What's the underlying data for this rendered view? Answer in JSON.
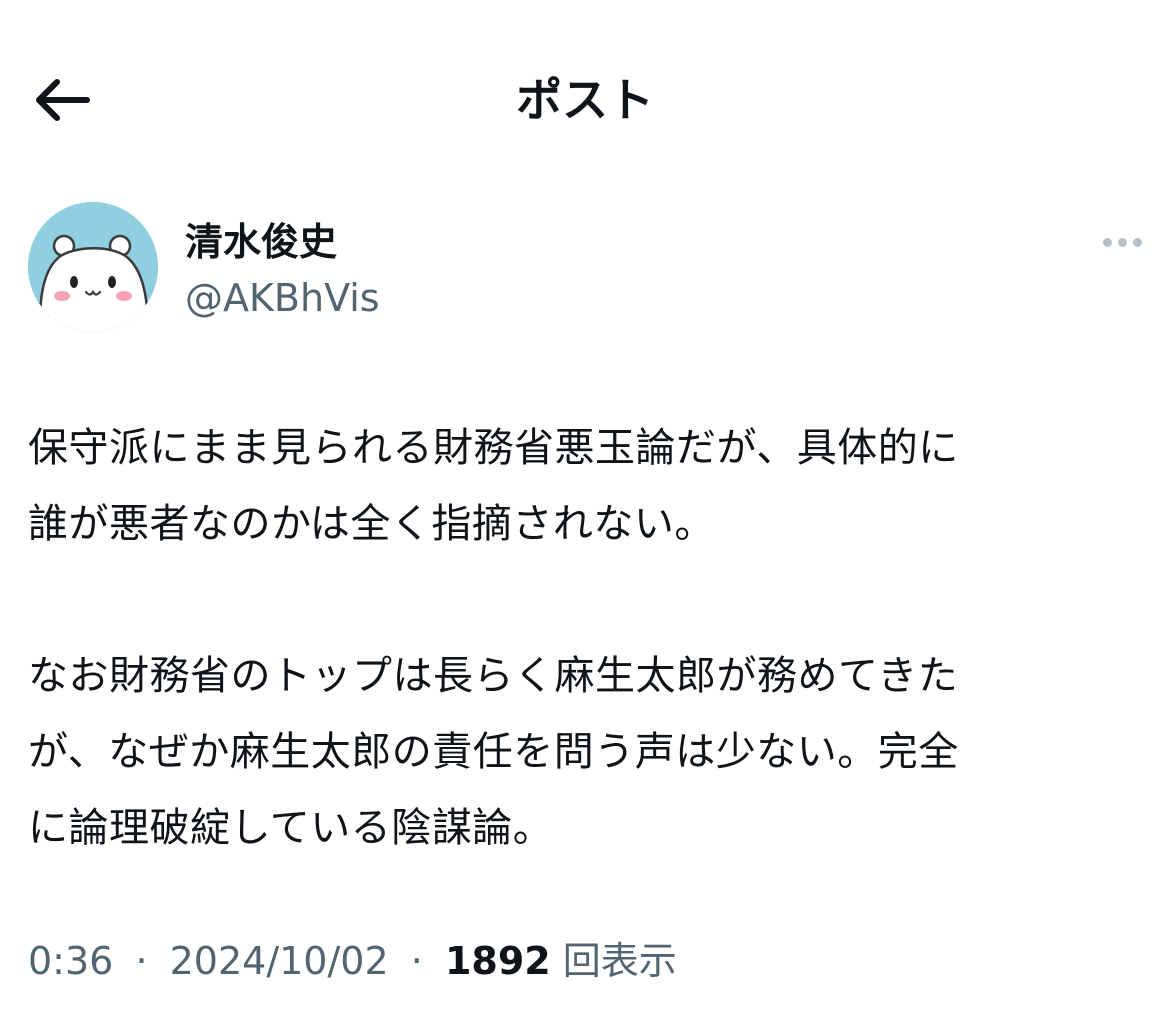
{
  "header": {
    "title": "ポスト"
  },
  "author": {
    "display_name": "清水俊史",
    "handle": "@AKBhVis"
  },
  "post": {
    "lines_para1": [
      "保守派にまま見られる財務省悪玉論だが、具体的に",
      "誰が悪者なのかは全く指摘されない。"
    ],
    "lines_para2": [
      "なお財務省のトップは長らく麻生太郎が務めてきた",
      "が、なぜか麻生太郎の責任を問う声は少ない。完全",
      "に論理破綻している陰謀論。"
    ]
  },
  "meta": {
    "time": "0:36",
    "separator": "·",
    "date": "2024/10/02",
    "views_count": "1892",
    "views_label": "回表示"
  },
  "colors": {
    "text": "#0f1419",
    "secondary": "#536471",
    "avatar_bg": "#8fcfe0"
  },
  "icons": {
    "back": "arrow-left-icon",
    "more": "more-dots-icon"
  }
}
